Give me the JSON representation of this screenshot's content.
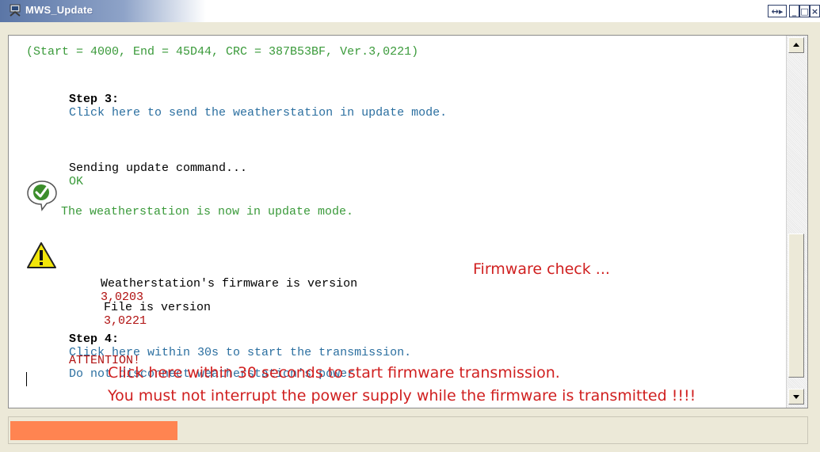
{
  "window": {
    "title": "MWS_Update",
    "buttons": {
      "resize": "↔▸",
      "minimize": "_",
      "maximize": "□",
      "close": "×"
    }
  },
  "log": {
    "line_header": "(Start = 4000, End = 45D44, CRC = 387B53BF, Ver.3,0221)",
    "step3_label": "Step 3:",
    "step3_link": "Click here to send the weatherstation in update mode.",
    "sending_text": "Sending update command...",
    "sending_ok": "OK",
    "update_mode_text": "The weatherstation is now in update mode.",
    "fw_station_text": "Weatherstation's firmware is version",
    "fw_station_version": "3,0203",
    "fw_annotation": "Firmware check ...",
    "fw_file_text": "File is version",
    "fw_file_version": "3,0221",
    "step4_label": "Step 4:",
    "step4_link": "Click here within 30s to start the transmission.",
    "attention_label": "ATTENTION!",
    "attention_text": "Do not disconnect weatherstation's power!",
    "annotation_line1": "Click here within 30 seconds to start firmware transmission.",
    "annotation_line2": "You must not interrupt the power supply while the firmware is transmitted !!!!"
  },
  "icons": {
    "success": "checkmark-icon",
    "warning": "warning-icon"
  },
  "progress": {
    "fraction": 0.21
  },
  "colors": {
    "green": "#3a9a3a",
    "blue_link": "#2b6fa0",
    "red": "#b01010",
    "annotation_red": "#d02020",
    "progress": "#ff8451"
  }
}
